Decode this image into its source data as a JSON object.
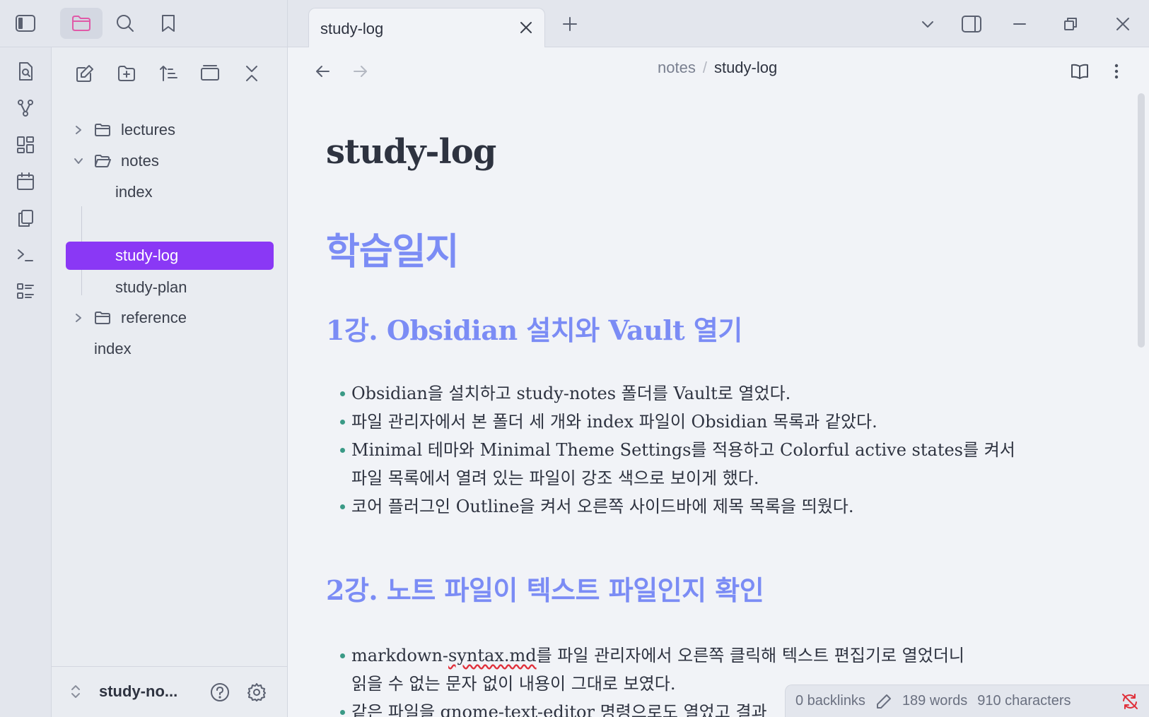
{
  "tab": {
    "title": "study-log"
  },
  "breadcrumb": {
    "folder": "notes",
    "separator": "/",
    "current": "study-log"
  },
  "explorer": {
    "tree": [
      {
        "label": "lectures",
        "type": "folder",
        "expanded": false
      },
      {
        "label": "notes",
        "type": "folder",
        "expanded": true
      },
      {
        "label": "index",
        "type": "file"
      },
      {
        "label": "study-log",
        "type": "file",
        "active": true
      },
      {
        "label": "study-plan",
        "type": "file"
      },
      {
        "label": "reference",
        "type": "folder",
        "expanded": false
      },
      {
        "label": "index",
        "type": "file"
      }
    ],
    "vault_name": "study-no..."
  },
  "note": {
    "title": "study-log",
    "h1": "학습일지",
    "sections": [
      {
        "heading": "1강. Obsidian 설치와 Vault 열기",
        "items": [
          [
            "Obsidian을 설치하고 study-notes 폴더를 Vault로 열었다."
          ],
          [
            "파일 관리자에서 본 폴더 세 개와 index 파일이 Obsidian 목록과 같았다."
          ],
          [
            "Minimal 테마와 Minimal Theme Settings를 적용하고 Colorful active states를 켜서",
            "파일 목록에서 열려 있는 파일이 강조 색으로 보이게 했다."
          ],
          [
            "코어 플러그인 Outline을 켜서 오른쪽 사이드바에 제목 목록을 띄웠다."
          ]
        ]
      },
      {
        "heading": "2강. 노트 파일이 텍스트 파일인지 확인",
        "items": [
          [
            "markdown-syntax.md를 파일 관리자에서 오른쪽 클릭해 텍스트 편집기로 열었더니",
            "읽을 수 없는 문자 없이 내용이 그대로 보였다."
          ],
          [
            "같은 파일을 gnome-text-editor 명령으로도 열었고 결과"
          ]
        ]
      }
    ],
    "misspelled_word": "syntax.md"
  },
  "status": {
    "backlinks": "0 backlinks",
    "words": "189 words",
    "characters": "910 characters"
  },
  "colors": {
    "accent": "#8a38f5",
    "heading": "#7b8cf5",
    "bullet": "#3a9a86",
    "files_icon": "#e05aa8",
    "sync_error": "#e0303a"
  }
}
